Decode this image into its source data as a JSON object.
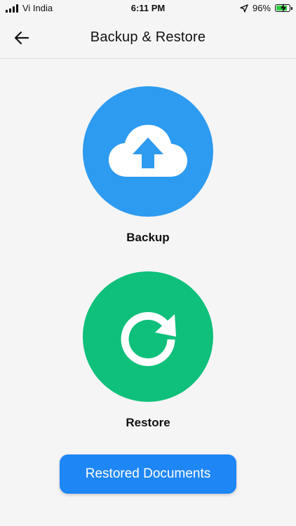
{
  "status_bar": {
    "carrier": "Vi India",
    "time": "6:11 PM",
    "battery_percent": "96%",
    "battery_level": 0.96
  },
  "header": {
    "title": "Backup & Restore"
  },
  "actions": {
    "backup_label": "Backup",
    "restore_label": "Restore"
  },
  "bottom_button": {
    "label": "Restored Documents"
  },
  "colors": {
    "backup_circle": "#2d9bf0",
    "restore_circle": "#0fc07b",
    "button_blue": "#1f86f5",
    "background": "#f5f5f5"
  },
  "icons": {
    "back": "arrow-left-icon",
    "backup": "cloud-upload-icon",
    "restore": "refresh-icon",
    "location": "location-arrow-icon",
    "battery": "battery-charging-icon"
  }
}
